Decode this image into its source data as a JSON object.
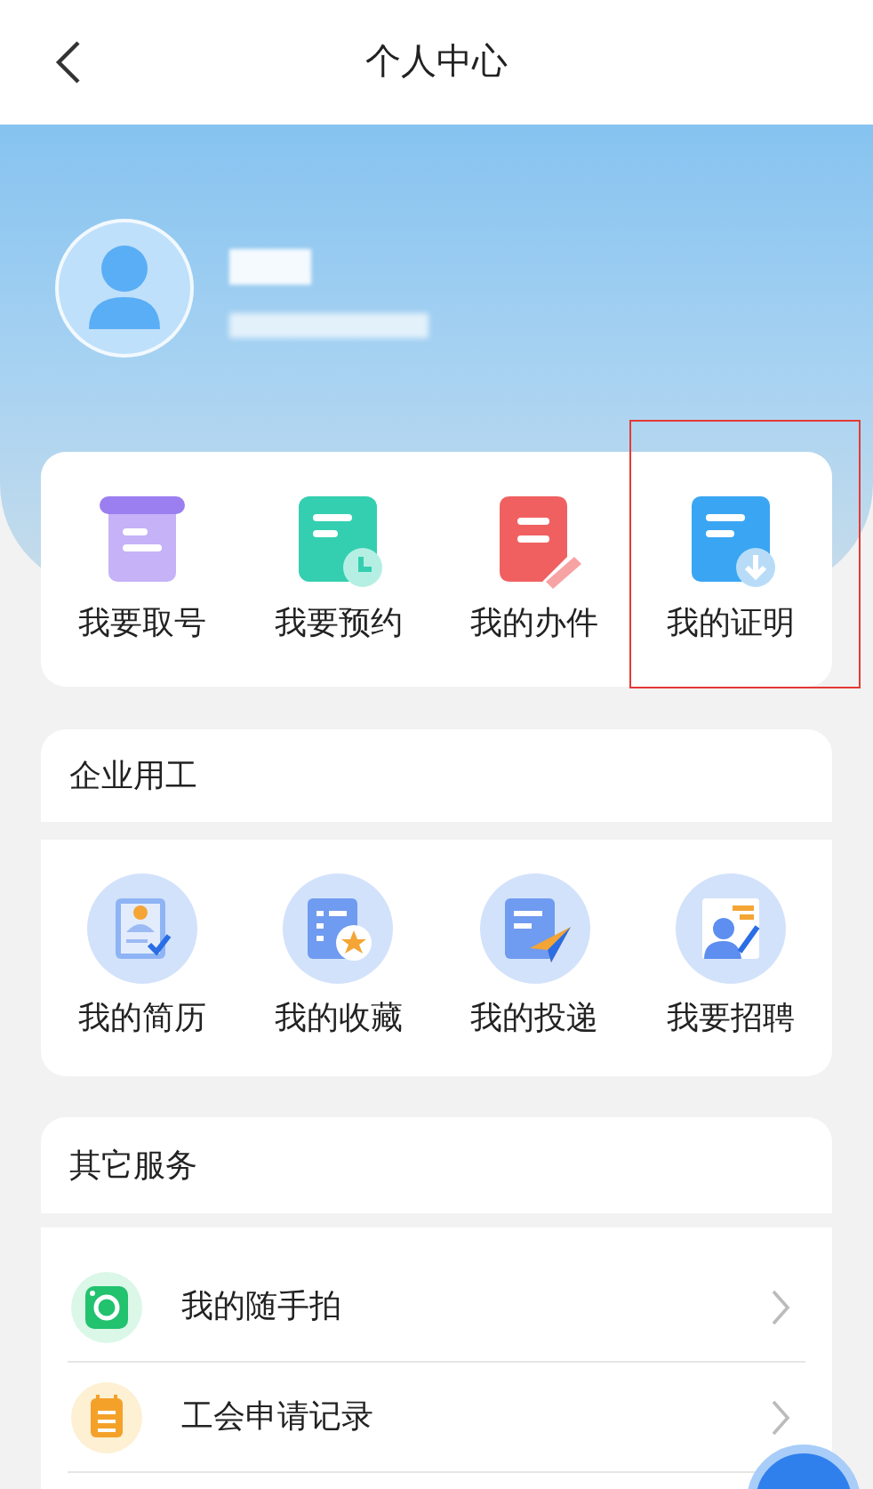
{
  "header": {
    "title": "个人中心"
  },
  "quick_services": [
    {
      "label": "我要取号",
      "highlighted": false
    },
    {
      "label": "我要预约",
      "highlighted": false
    },
    {
      "label": "我的办件",
      "highlighted": false
    },
    {
      "label": "我的证明",
      "highlighted": true
    }
  ],
  "employment": {
    "title": "企业用工",
    "items": [
      {
        "label": "我的简历"
      },
      {
        "label": "我的收藏"
      },
      {
        "label": "我的投递"
      },
      {
        "label": "我要招聘"
      }
    ]
  },
  "other_services": {
    "title": "其它服务",
    "items": [
      {
        "label": "我的随手拍"
      },
      {
        "label": "工会申请记录"
      }
    ]
  }
}
